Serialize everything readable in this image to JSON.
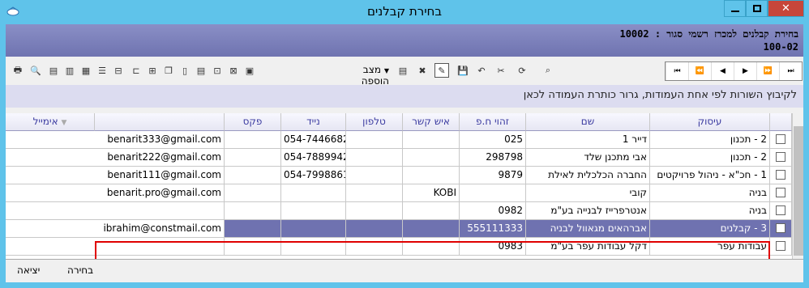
{
  "window": {
    "title": "בחירת קבלנים"
  },
  "header": {
    "line1": "בחירת קבלנים למכרז רשמי סגור : 10002",
    "line2": "100-02"
  },
  "toolbar": {
    "add_mode_label": "מצב הוספה"
  },
  "group_hint": "לקיבוץ השורות לפי אחת העמודות, גרור כותרת העמודה לכאן",
  "columns": {
    "field": "עיסוק",
    "name": "שם",
    "id": "זהוי ח.פ",
    "contact": "איש קשר",
    "phone": "טלפון",
    "mobile": "נייד",
    "fax": "פקס",
    "email": "אימייל"
  },
  "rows": [
    {
      "field": "2 - תכנון",
      "name": "דייר 1",
      "id": "025",
      "contact": "",
      "phone": "",
      "mobile": "054-7446682",
      "fax": "",
      "email": "benarit333@gmail.com"
    },
    {
      "field": "2 - תכנון",
      "name": "אבי מתכנן שלד",
      "id": "298798",
      "contact": "",
      "phone": "",
      "mobile": "054-7889942",
      "fax": "",
      "email": "benarit222@gmail.com"
    },
    {
      "field": "1 - חכ\"א - ניהול פרויקטים",
      "name": "החברה הכלכלית לאילת",
      "id": "9879",
      "contact": "",
      "phone": "",
      "mobile": "054-7998861",
      "fax": "",
      "email": "benarit111@gmail.com"
    },
    {
      "field": "בניה",
      "name": "קובי",
      "id": "",
      "contact": "KOBI",
      "phone": "",
      "mobile": "",
      "fax": "",
      "email": "benarit.pro@gmail.com"
    },
    {
      "field": "בניה",
      "name": "אנטרפרייז לבנייה בע\"מ",
      "id": "0982",
      "contact": "",
      "phone": "",
      "mobile": "",
      "fax": "",
      "email": ""
    },
    {
      "field": "3 - קבלנים",
      "name": "אברהאים מגאוול לבניה",
      "id": "555111333",
      "contact": "",
      "phone": "",
      "mobile": "",
      "fax": "",
      "email": "ibrahim@constmail.com"
    },
    {
      "field": "עבודות עפר",
      "name": "דקל עבודות עפר בע\"מ",
      "id": "0983",
      "contact": "",
      "phone": "",
      "mobile": "",
      "fax": "",
      "email": ""
    }
  ],
  "bottom": {
    "select_label": "בחירה",
    "exit_label": "יציאה"
  },
  "colors": {
    "titlebar": "#5fc3ea",
    "header_band": "#7b7fbb",
    "selected_row": "#6f72b0",
    "highlight_border": "#e00000"
  }
}
